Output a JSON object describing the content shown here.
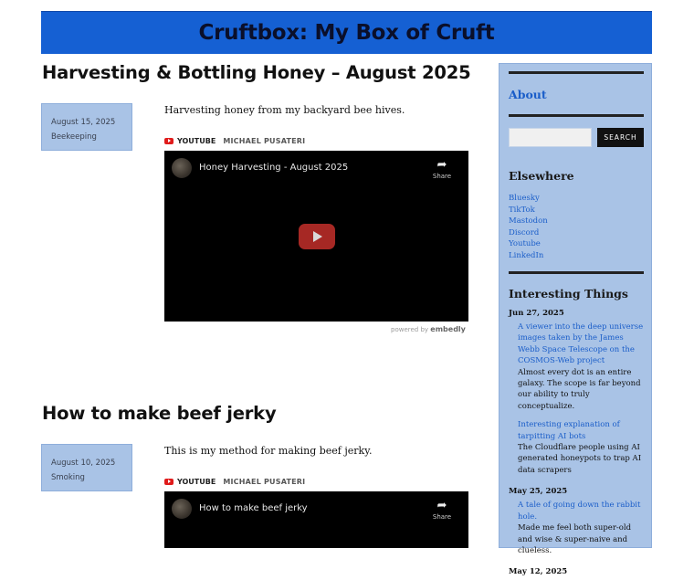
{
  "site": {
    "title": "Cruftbox: My Box of Cruft"
  },
  "posts": [
    {
      "title": "Harvesting & Bottling Honey – August 2025",
      "date": "August 15, 2025",
      "category": "Beekeeping",
      "excerpt": "Harvesting honey from my backyard bee hives.",
      "embed": {
        "provider": "YOUTUBE",
        "author": "MICHAEL PUSATERI",
        "video_title": "Honey Harvesting - August 2025",
        "share_label": "Share",
        "powered_prefix": "powered by",
        "powered_brand": "embedly"
      }
    },
    {
      "title": "How to make beef jerky",
      "date": "August 10, 2025",
      "category": "Smoking",
      "excerpt": "This is my method for making beef jerky.",
      "embed": {
        "provider": "YOUTUBE",
        "author": "MICHAEL PUSATERI",
        "video_title": "How to make beef jerky",
        "share_label": "Share"
      }
    }
  ],
  "sidebar": {
    "about_title": "About",
    "search": {
      "placeholder": "",
      "button_label": "Search"
    },
    "elsewhere_title": "Elsewhere",
    "links": [
      "Bluesky",
      "TikTok",
      "Mastodon",
      "Discord",
      "Youtube",
      "LinkedIn"
    ],
    "interesting_title": "Interesting Things",
    "things": [
      {
        "date": "Jun 27, 2025",
        "items": [
          {
            "link": "A viewer into the deep universe images taken by the James Webb Space Telescope on the COSMOS-Web project",
            "note": "Almost every dot is an entire galaxy. The scope is far beyond our ability to truly conceptualize."
          },
          {
            "link": "Interesting explanation of tarpitting AI bots",
            "note": "The Cloudflare people using AI generated honeypots to trap AI data scrapers"
          }
        ]
      },
      {
        "date": "May 25, 2025",
        "items": [
          {
            "link": "A tale of going down the rabbit hole.",
            "note": "Made me feel both super-old and wise & super-naive and clueless."
          }
        ]
      },
      {
        "date": "May 12, 2025",
        "items": []
      }
    ]
  },
  "colors": {
    "header_bg": "#1560d3",
    "sidebar_bg": "#a9c3e6",
    "link": "#1b5ec9"
  },
  "icons": {
    "video_badge": "youtube-icon",
    "share": "share-arrow-icon",
    "play": "play-icon"
  }
}
